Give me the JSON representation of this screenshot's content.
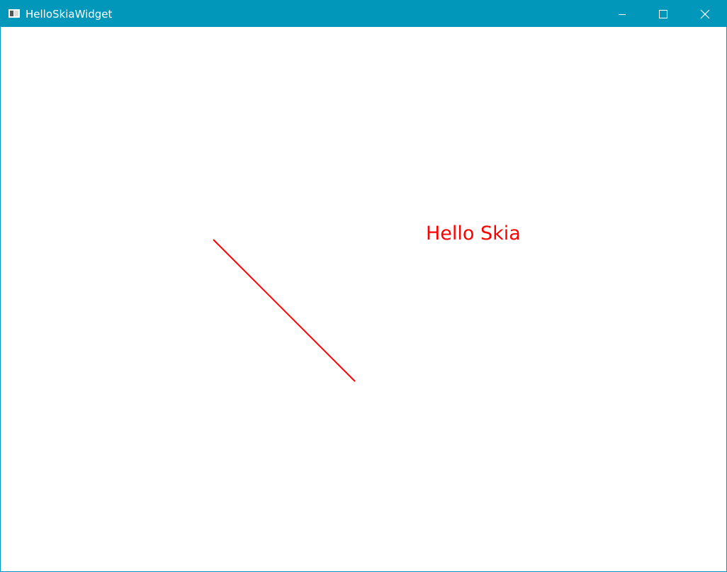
{
  "window": {
    "title": "HelloSkiaWidget",
    "accent_color": "#0097bb",
    "icons": {
      "app": "app-window-icon",
      "minimize": "minimize-icon",
      "maximize": "maximize-icon",
      "close": "close-icon"
    }
  },
  "canvas": {
    "text": "Hello Skia",
    "draw_color": "#ff0000"
  }
}
